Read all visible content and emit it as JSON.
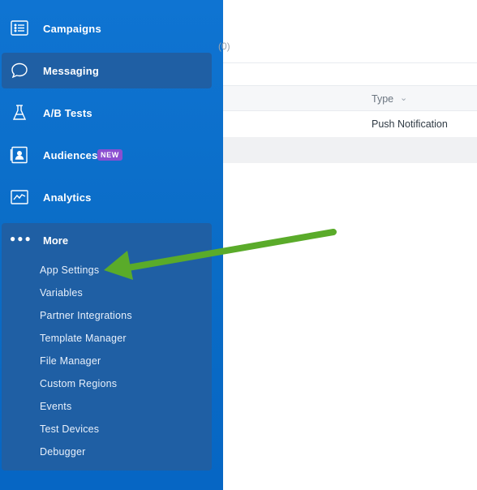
{
  "sidebar": {
    "items": [
      {
        "label": "Campaigns",
        "icon": "list-icon"
      },
      {
        "label": "Messaging",
        "icon": "chat-bubble-icon",
        "active": true
      },
      {
        "label": "A/B Tests",
        "icon": "beaker-icon"
      },
      {
        "label": "Audiences",
        "icon": "person-card-icon",
        "badge": "NEW"
      },
      {
        "label": "Analytics",
        "icon": "chart-line-icon"
      }
    ],
    "more": {
      "label": "More",
      "icon": "dots-icon",
      "subitems": [
        "App Settings",
        "Variables",
        "Partner Integrations",
        "Template Manager",
        "File Manager",
        "Custom Regions",
        "Events",
        "Test Devices",
        "Debugger"
      ]
    }
  },
  "main": {
    "count_text": "(0)",
    "columns": {
      "type": "Type"
    },
    "rows": [
      {
        "type": "Push Notification"
      }
    ]
  },
  "colors": {
    "sidebar": "#0a6cc6",
    "sidebar_active": "#1f5fa4",
    "badge": "#8a4fd0",
    "arrow": "#5aab2a"
  }
}
